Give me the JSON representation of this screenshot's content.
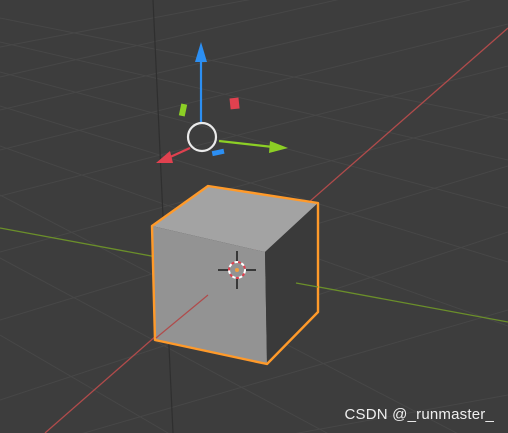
{
  "viewport": {
    "background": "#3d3d3d",
    "grid_color": "#474747",
    "x_axis_color": "#b04b4b",
    "y_axis_color": "#6b8f2a",
    "z_axis_color": "#3b3b3b"
  },
  "object": {
    "name_icon": "cube-icon",
    "selected": true,
    "outline_color": "#ff9a2a",
    "face_top_color": "#a3a3a3",
    "face_front_color": "#8f8f8f",
    "face_side_color": "#3a3a3a"
  },
  "gizmo": {
    "x_color": "#e0414f",
    "y_color": "#8ccf25",
    "z_color": "#2c8ff3"
  },
  "watermark": "CSDN @_runmaster_"
}
